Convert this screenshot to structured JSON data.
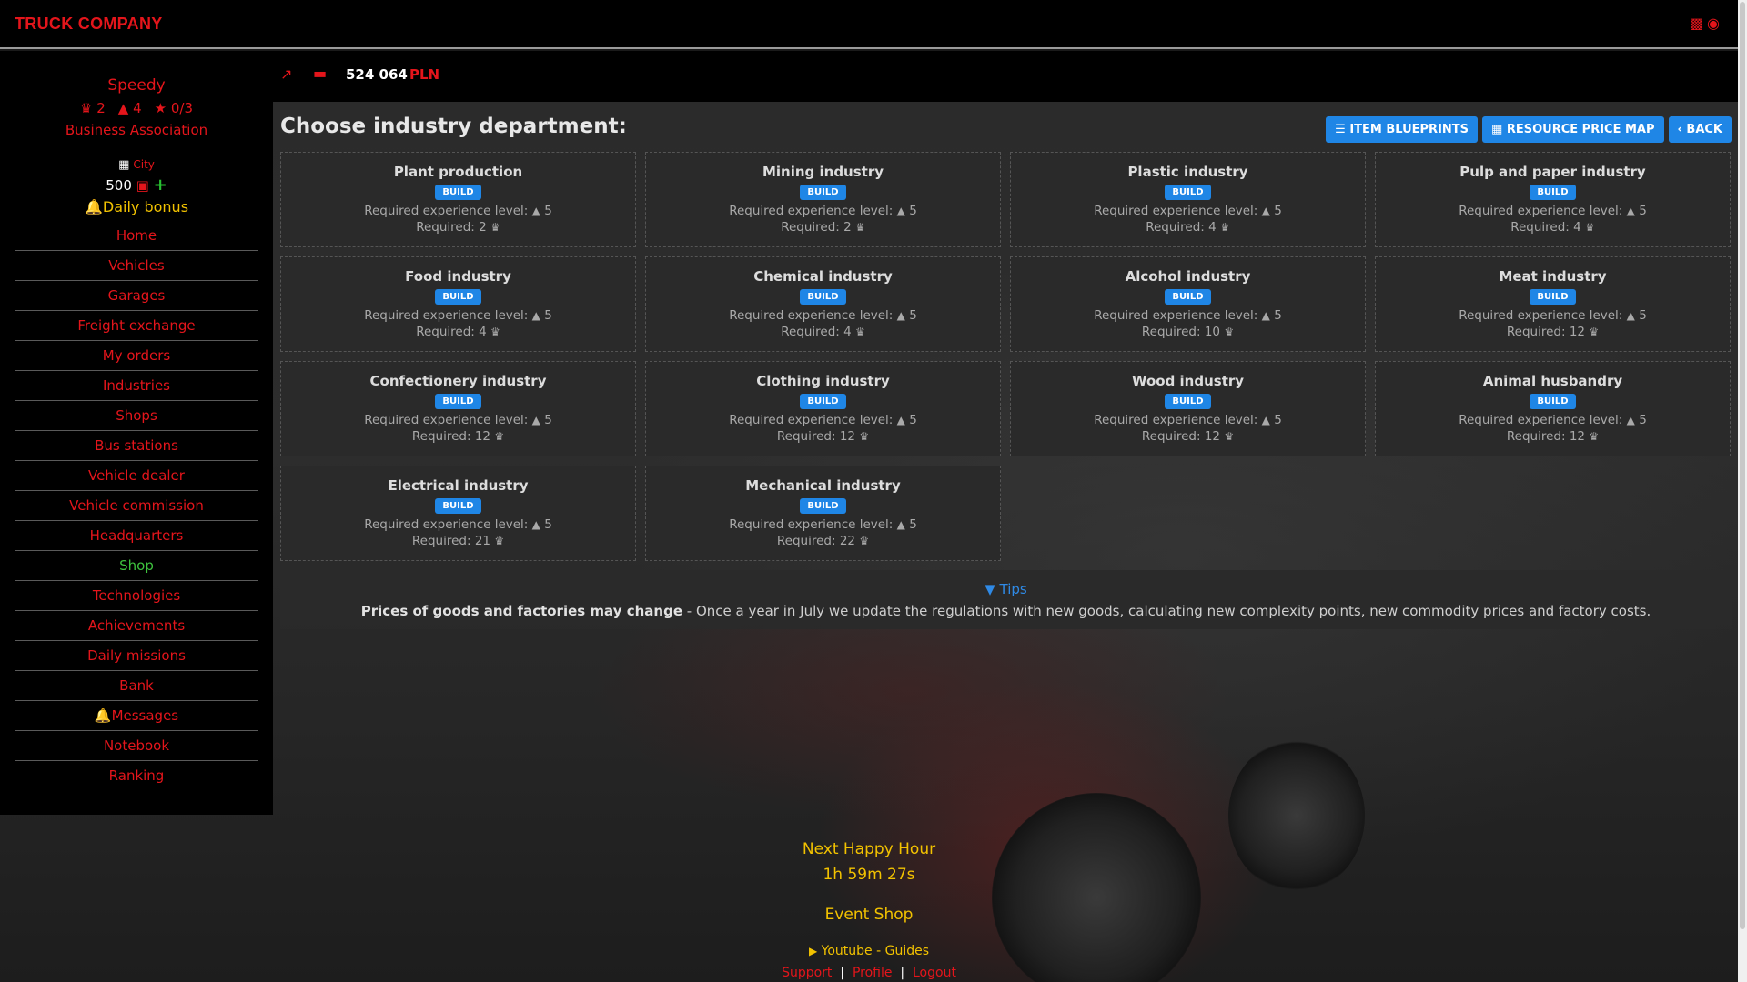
{
  "app": {
    "brand": "TRUCK COMPANY"
  },
  "user": {
    "name": "Speedy",
    "crowns": "2",
    "hats": "4",
    "stars": "0/3",
    "association": "Business Association",
    "location": "City",
    "tokens": "500",
    "daily_bonus": "Daily bonus"
  },
  "sidebar": {
    "items": [
      {
        "label": "Home"
      },
      {
        "label": "Vehicles"
      },
      {
        "label": "Garages"
      },
      {
        "label": "Freight exchange"
      },
      {
        "label": "My orders"
      },
      {
        "label": "Industries"
      },
      {
        "label": "Shops"
      },
      {
        "label": "Bus stations"
      },
      {
        "label": "Vehicle dealer"
      },
      {
        "label": "Vehicle commission"
      },
      {
        "label": "Headquarters"
      },
      {
        "label": "Shop"
      },
      {
        "label": "Technologies"
      },
      {
        "label": "Achievements"
      },
      {
        "label": "Daily missions"
      },
      {
        "label": "Bank"
      },
      {
        "label": "Messages"
      },
      {
        "label": "Notebook"
      },
      {
        "label": "Ranking"
      }
    ]
  },
  "balance": {
    "amount": "524 064",
    "currency": "PLN"
  },
  "main": {
    "heading": "Choose industry department:",
    "buttons": {
      "blueprints": "ITEM BLUEPRINTS",
      "price_map": "RESOURCE PRICE MAP",
      "back": "BACK"
    },
    "build_label": "BUILD",
    "req_exp_label": "Required experience level:",
    "req_label": "Required:",
    "industries": [
      {
        "name": "Plant production",
        "exp": "5",
        "required": "2"
      },
      {
        "name": "Mining industry",
        "exp": "5",
        "required": "2"
      },
      {
        "name": "Plastic industry",
        "exp": "5",
        "required": "4"
      },
      {
        "name": "Pulp and paper industry",
        "exp": "5",
        "required": "4"
      },
      {
        "name": "Food industry",
        "exp": "5",
        "required": "4"
      },
      {
        "name": "Chemical industry",
        "exp": "5",
        "required": "4"
      },
      {
        "name": "Alcohol industry",
        "exp": "5",
        "required": "10"
      },
      {
        "name": "Meat industry",
        "exp": "5",
        "required": "12"
      },
      {
        "name": "Confectionery industry",
        "exp": "5",
        "required": "12"
      },
      {
        "name": "Clothing industry",
        "exp": "5",
        "required": "12"
      },
      {
        "name": "Wood industry",
        "exp": "5",
        "required": "12"
      },
      {
        "name": "Animal husbandry",
        "exp": "5",
        "required": "12"
      },
      {
        "name": "Electrical industry",
        "exp": "5",
        "required": "21"
      },
      {
        "name": "Mechanical industry",
        "exp": "5",
        "required": "22"
      }
    ],
    "tips": {
      "title": "Tips",
      "bold": "Prices of goods and factories may change",
      "text": " - Once a year in July we update the regulations with new goods, calculating new complexity points, new commodity prices and factory costs."
    }
  },
  "footer": {
    "happy_hour_label": "Next Happy Hour",
    "happy_hour_time": "1h 59m 27s",
    "event_shop": "Event Shop",
    "youtube": "Youtube - Guides",
    "support": "Support",
    "profile": "Profile",
    "logout": "Logout"
  },
  "colors": {
    "accent": "#e4151b",
    "button": "#1f86e6",
    "gold": "#f2c200",
    "green": "#3ec23e"
  },
  "icons": {
    "stats": [
      "crown-icon",
      "hat-icon",
      "star-icon"
    ],
    "header": [
      "chart-icon",
      "wallet-icon"
    ],
    "top_right": [
      "truck-icon",
      "toggle-icon"
    ]
  }
}
